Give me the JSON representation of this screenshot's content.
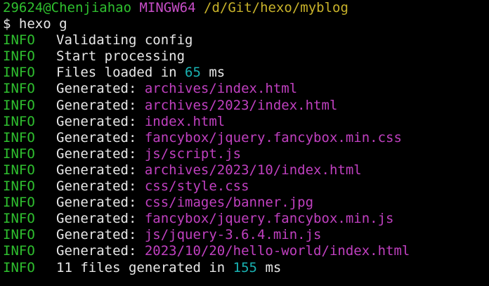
{
  "prompt": {
    "user_host": "29624@Chenjiahao",
    "system": "MINGW64",
    "cwd": "/d/Git/hexo/myblog",
    "symbol": "$",
    "command": "hexo g"
  },
  "log_level": "INFO",
  "lines": [
    {
      "text": "Validating config"
    },
    {
      "text": "Start processing"
    },
    {
      "prefix": "Files loaded in ",
      "number": "65",
      "suffix": " ms"
    },
    {
      "prefix": "Generated: ",
      "file": "archives/index.html"
    },
    {
      "prefix": "Generated: ",
      "file": "archives/2023/index.html"
    },
    {
      "prefix": "Generated: ",
      "file": "index.html"
    },
    {
      "prefix": "Generated: ",
      "file": "fancybox/jquery.fancybox.min.css"
    },
    {
      "prefix": "Generated: ",
      "file": "js/script.js"
    },
    {
      "prefix": "Generated: ",
      "file": "archives/2023/10/index.html"
    },
    {
      "prefix": "Generated: ",
      "file": "css/style.css"
    },
    {
      "prefix": "Generated: ",
      "file": "css/images/banner.jpg"
    },
    {
      "prefix": "Generated: ",
      "file": "fancybox/jquery.fancybox.min.js"
    },
    {
      "prefix": "Generated: ",
      "file": "js/jquery-3.6.4.min.js"
    },
    {
      "prefix": "Generated: ",
      "file": "2023/10/20/hello-world/index.html"
    },
    {
      "prefix": "11 files generated in ",
      "number": "155",
      "suffix": " ms"
    }
  ],
  "colors": {
    "background": "#000000",
    "user": "#2fc02f",
    "system": "#c74dc7",
    "path": "#c8b22a",
    "info": "#2fc02f",
    "text": "#e8e8e8",
    "file": "#c040c0",
    "number": "#19b3b3"
  }
}
